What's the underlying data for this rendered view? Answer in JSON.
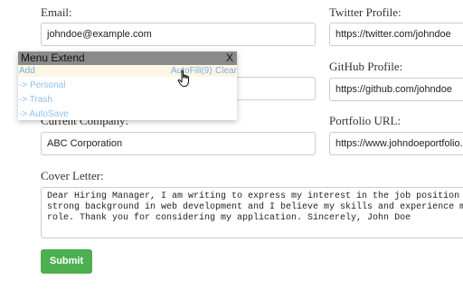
{
  "form": {
    "email_label": "Email:",
    "email_value": "johndoe@example.com",
    "twitter_label": "Twitter Profile:",
    "twitter_value": "https://twitter.com/johndoe",
    "github_label": "GitHub Profile:",
    "github_value": "https://github.com/johndoe",
    "company_label": "Current Company:",
    "company_value": "ABC Corporation",
    "portfolio_label": "Portfolio URL:",
    "portfolio_value": "https://www.johndoeportfolio.c",
    "cover_label": "Cover Letter:",
    "cover_lines": [
      "Dear Hiring Manager, I am writing to express my interest in the job position at",
      "strong background in web development and I believe my skills and experience mak",
      "role. Thank you for considering my application. Sincerely, John Doe"
    ],
    "submit_label": "Submit"
  },
  "popup": {
    "title": "Menu Extend",
    "close": "X",
    "add": "Add",
    "autofill": "AutoFill(9)",
    "clear": "Clear",
    "items": [
      "-> Personal",
      "-> Trash",
      "-> AutoSave"
    ]
  },
  "colors": {
    "submit_bg": "#4caf50",
    "popup_header": "#8a8a8a",
    "popup_link": "#7aaee4"
  },
  "icons": {
    "cursor": "hand-pointer-icon"
  }
}
